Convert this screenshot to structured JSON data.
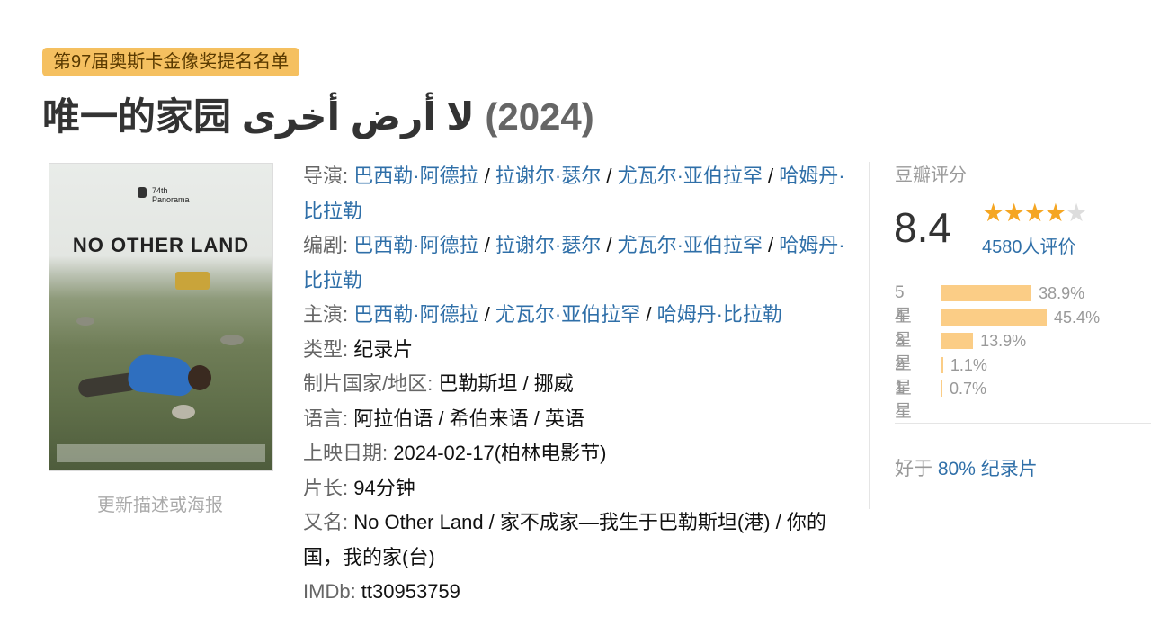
{
  "badge": "第97届奥斯卡金像奖提名名单",
  "title": {
    "cn": "唯一的家园",
    "original": "لا أرض أخرى",
    "year": "(2024)"
  },
  "poster": {
    "festival": "74th",
    "festival_sub": "Panorama",
    "title": "NO OTHER LAND",
    "update_link": "更新描述或海报"
  },
  "info": {
    "director_label": "导演",
    "directors": [
      "巴西勒·阿德拉",
      "拉谢尔·瑟尔",
      "尤瓦尔·亚伯拉罕",
      "哈姆丹·比拉勒"
    ],
    "writer_label": "编剧",
    "writers": [
      "巴西勒·阿德拉",
      "拉谢尔·瑟尔",
      "尤瓦尔·亚伯拉罕",
      "哈姆丹·比拉勒"
    ],
    "cast_label": "主演",
    "cast": [
      "巴西勒·阿德拉",
      "尤瓦尔·亚伯拉罕",
      "哈姆丹·比拉勒"
    ],
    "genre_label": "类型",
    "genre": "纪录片",
    "country_label": "制片国家/地区",
    "country": "巴勒斯坦 / 挪威",
    "language_label": "语言",
    "language": "阿拉伯语 / 希伯来语 / 英语",
    "release_label": "上映日期",
    "release": "2024-02-17(柏林电影节)",
    "runtime_label": "片长",
    "runtime": "94分钟",
    "aka_label": "又名",
    "aka": "No Other Land / 家不成家—我生于巴勒斯坦(港) / 你的国，我的家(台)",
    "imdb_label": "IMDb",
    "imdb": "tt30953759"
  },
  "rating": {
    "title": "豆瓣评分",
    "score": "8.4",
    "stars": 4,
    "count": "4580人评价",
    "distribution": [
      {
        "label": "5星",
        "percent": "38.9%",
        "value": 38.9
      },
      {
        "label": "4星",
        "percent": "45.4%",
        "value": 45.4
      },
      {
        "label": "3星",
        "percent": "13.9%",
        "value": 13.9
      },
      {
        "label": "2星",
        "percent": "1.1%",
        "value": 1.1
      },
      {
        "label": "1星",
        "percent": "0.7%",
        "value": 0.7
      }
    ],
    "better_prefix": "好于",
    "better_link": "80% 纪录片"
  },
  "colors": {
    "badge_bg": "#f5c060",
    "link": "#2f6fa8",
    "star": "#f5a623",
    "bar": "#fbcd86"
  }
}
